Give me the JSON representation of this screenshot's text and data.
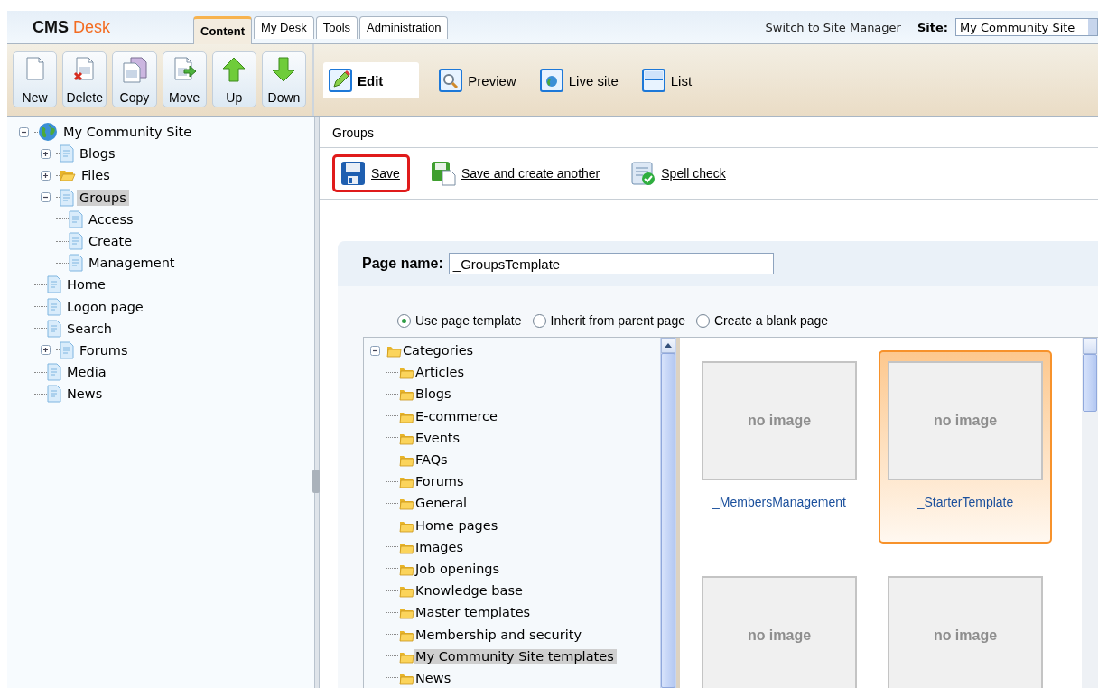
{
  "header": {
    "logo": {
      "primary": "CMS",
      "accent": "Desk"
    },
    "tabs": [
      {
        "label": "Content",
        "selected": true
      },
      {
        "label": "My Desk",
        "selected": false
      },
      {
        "label": "Tools",
        "selected": false
      },
      {
        "label": "Administration",
        "selected": false
      }
    ],
    "switch_link": "Switch to Site Manager",
    "site_label": "Site:",
    "site_value": "My Community Site"
  },
  "toolbar": [
    {
      "label": "New",
      "kind": "new"
    },
    {
      "label": "Delete",
      "kind": "delete"
    },
    {
      "label": "Copy",
      "kind": "copy"
    },
    {
      "label": "Move",
      "kind": "move"
    },
    {
      "label": "Up",
      "kind": "up"
    },
    {
      "label": "Down",
      "kind": "down"
    }
  ],
  "view_tabs": [
    {
      "label": "Edit",
      "kind": "edit",
      "selected": true
    },
    {
      "label": "Preview",
      "kind": "preview",
      "selected": false
    },
    {
      "label": "Live site",
      "kind": "live",
      "selected": false
    },
    {
      "label": "List",
      "kind": "list",
      "selected": false
    }
  ],
  "content_tree": {
    "label": "My Community Site",
    "kind": "globe",
    "expanded": true,
    "selected": false,
    "children": [
      {
        "label": "Blogs",
        "kind": "page",
        "expanded": false,
        "selected": false
      },
      {
        "label": "Files",
        "kind": "folder",
        "expanded": false,
        "selected": false
      },
      {
        "label": "Groups",
        "kind": "page",
        "expanded": true,
        "selected": true,
        "children": [
          {
            "label": "Access",
            "kind": "page",
            "selected": false
          },
          {
            "label": "Create",
            "kind": "page",
            "selected": false
          },
          {
            "label": "Management",
            "kind": "page",
            "selected": false
          }
        ]
      },
      {
        "label": "Home",
        "kind": "page",
        "selected": false
      },
      {
        "label": "Logon page",
        "kind": "page",
        "selected": false
      },
      {
        "label": "Search",
        "kind": "page",
        "selected": false
      },
      {
        "label": "Forums",
        "kind": "page",
        "expanded": false,
        "selected": false
      },
      {
        "label": "Media",
        "kind": "page",
        "selected": false
      },
      {
        "label": "News",
        "kind": "page",
        "selected": false
      }
    ]
  },
  "breadcrumb": "Groups",
  "actions": [
    {
      "label": "Save",
      "kind": "save",
      "highlighted": true
    },
    {
      "label": "Save and create another",
      "kind": "save_another",
      "highlighted": false
    },
    {
      "label": "Spell check",
      "kind": "spell",
      "highlighted": false
    }
  ],
  "form": {
    "page_name_label": "Page name:",
    "page_name_value": "_GroupsTemplate",
    "options": [
      {
        "label": "Use page template",
        "selected": true
      },
      {
        "label": "Inherit from parent page",
        "selected": false
      },
      {
        "label": "Create a blank page",
        "selected": false
      }
    ],
    "categories": {
      "label": "Categories",
      "expanded": true,
      "children": [
        {
          "label": "Articles",
          "selected": false
        },
        {
          "label": "Blogs",
          "selected": false
        },
        {
          "label": "E-commerce",
          "selected": false
        },
        {
          "label": "Events",
          "selected": false
        },
        {
          "label": "FAQs",
          "selected": false
        },
        {
          "label": "Forums",
          "selected": false
        },
        {
          "label": "General",
          "selected": false
        },
        {
          "label": "Home pages",
          "selected": false
        },
        {
          "label": "Images",
          "selected": false
        },
        {
          "label": "Job openings",
          "selected": false
        },
        {
          "label": "Knowledge base",
          "selected": false
        },
        {
          "label": "Master templates",
          "selected": false
        },
        {
          "label": "Membership and security",
          "selected": false
        },
        {
          "label": "My Community Site templates",
          "selected": true
        },
        {
          "label": "News",
          "selected": false
        }
      ]
    },
    "templates": [
      {
        "image_text": "no image",
        "name": "_MembersManagement",
        "selected": false
      },
      {
        "image_text": "no image",
        "name": "_StarterTemplate",
        "selected": true
      },
      {
        "image_text": "no image",
        "selected": false
      },
      {
        "image_text": "no image",
        "selected": false
      }
    ]
  }
}
